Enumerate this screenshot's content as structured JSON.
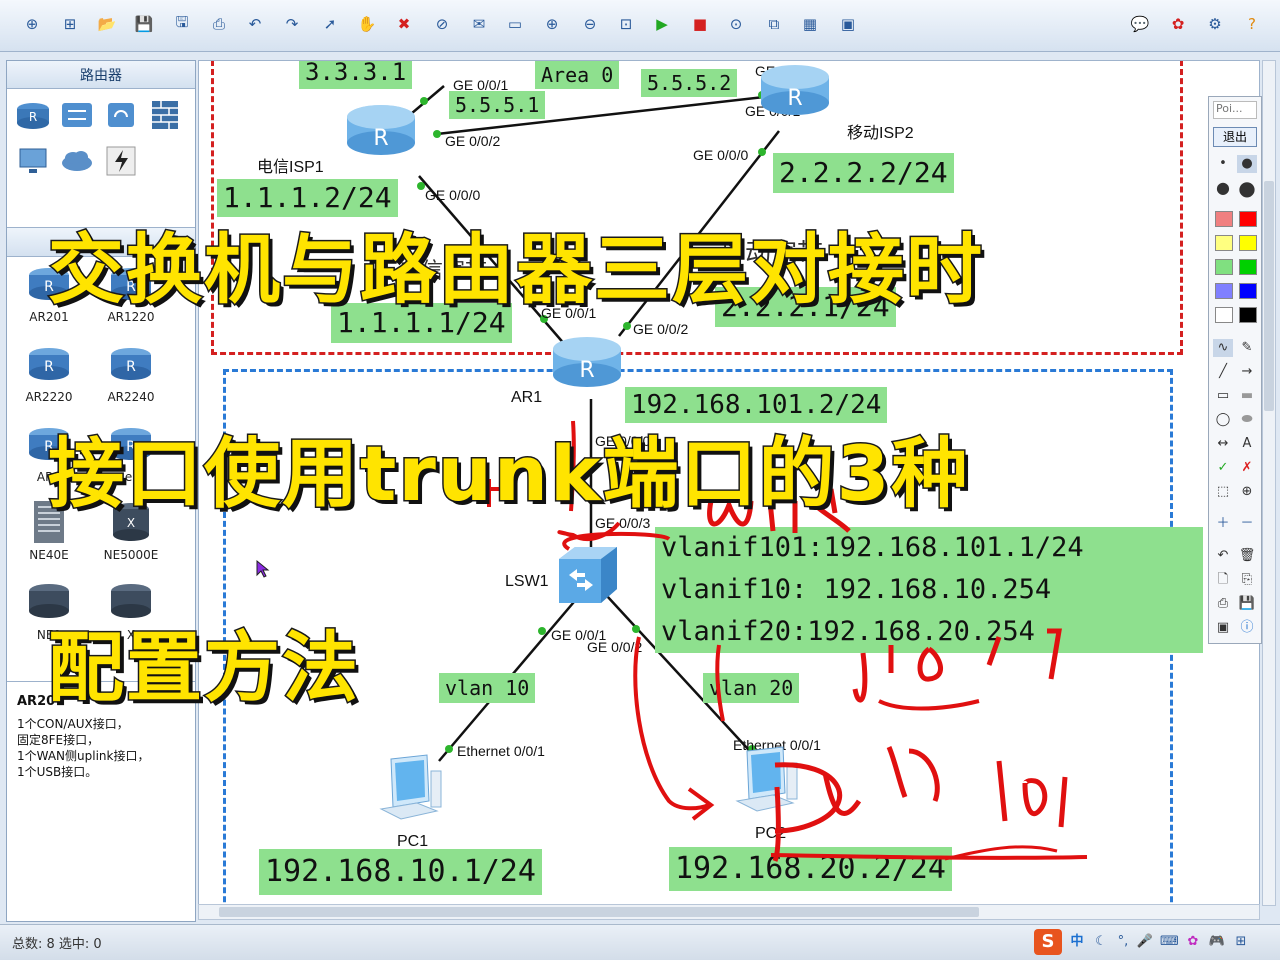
{
  "toolbar": {
    "icons": [
      "new-topology-icon",
      "new-example-icon",
      "open-icon",
      "save-icon",
      "save-as-icon",
      "print-icon",
      "undo-icon",
      "redo-icon",
      "select-icon",
      "hand-icon",
      "delete-icon",
      "delete-link-icon",
      "add-text-icon",
      "palette-icon",
      "zoom-in-icon",
      "zoom-out-icon",
      "fit-icon",
      "start-device-icon",
      "stop-device-icon",
      "capture-icon",
      "topology-icon",
      "grid-icon",
      "console-icon",
      "chat-icon",
      "huawei-icon",
      "settings-icon",
      "help-icon"
    ]
  },
  "left_panel": {
    "title": "路由器",
    "devices": [
      {
        "name": "AR201"
      },
      {
        "name": "AR1220"
      },
      {
        "name": "AR2220"
      },
      {
        "name": "AR2240"
      },
      {
        "name": "AR3"
      },
      {
        "name": "er"
      },
      {
        "name": "NE40E"
      },
      {
        "name": "NE5000E"
      },
      {
        "name": "NE9"
      },
      {
        "name": "X"
      }
    ],
    "desc_title": "AR20",
    "desc_lines": [
      "1个CON/AUX接口，",
      "固定8FE接口，",
      "1个WAN侧uplink接口，",
      "1个USB接口。"
    ]
  },
  "topology": {
    "area_label": "Area 0",
    "devices": {
      "isp1": "电信ISP1",
      "isp2": "移动ISP2",
      "ar1": "AR1",
      "lsw1": "LSW1",
      "pc1": "PC1",
      "pc2": "PC2"
    },
    "ips": {
      "top_left": "3.3.3.1",
      "isp1_up": "5.5.5.1",
      "isp2_up": "5.5.5.2",
      "isp1_down": "1.1.1.2/24",
      "isp2_down": "2.2.2.2/24",
      "ar1_left": "1.1.1.1/24",
      "ar1_right": "2.2.2.1/24",
      "ar1_down": "192.168.101.2/24",
      "vlanif101": "vlanif101:192.168.101.1/24",
      "vlanif10": "vlanif10: 192.168.10.254",
      "vlanif20": "vlanif20:192.168.20.254",
      "pc1": "192.168.10.1/24",
      "pc2": "192.168.20.2/24",
      "vlan10": "vlan 10",
      "vlan20": "vlan 20"
    },
    "ports": {
      "isp1_ge001": "GE 0/0/1",
      "isp1_ge002": "GE 0/0/2",
      "isp1_ge000": "GE 0/0/0",
      "isp2_ge002": "GE 0/0/2",
      "isp2_ge001": "GE 0/0/1",
      "isp2_ge000": "GE 0/0/0",
      "ar1_ge001": "GE 0/0/1",
      "ar1_ge002": "GE 0/0/2",
      "ar1_ge000": "GE 0/0/0",
      "lsw_ge003": "GE 0/0/3",
      "lsw_ge001": "GE 0/0/1",
      "lsw_ge002": "GE 0/0/2",
      "pc1_eth": "Ethernet 0/0/1",
      "pc2_eth": "Ethernet 0/0/1"
    },
    "hidden_labels": {
      "cn_left": "电信宽带",
      "cn_right": "移动宽带"
    }
  },
  "overlay_title": {
    "line1": "交换机与路由器三层对接时",
    "line2": "接口使用trunk端口的3种",
    "line3": "配置方法"
  },
  "annotations": {
    "trunk_note": "trunk",
    "pvid_note": "PVID 101"
  },
  "draw_toolbox": {
    "pointer": "Poi...",
    "exit": "退出"
  },
  "status_bar": {
    "text": "总数: 8 选中: 0"
  },
  "colors": {
    "ip_bg": "#8ee08e",
    "red_zone": "#d42020",
    "blue_zone": "#2a7ad6",
    "overlay_yellow": "#ffe400",
    "pen_red": "#e01010"
  }
}
